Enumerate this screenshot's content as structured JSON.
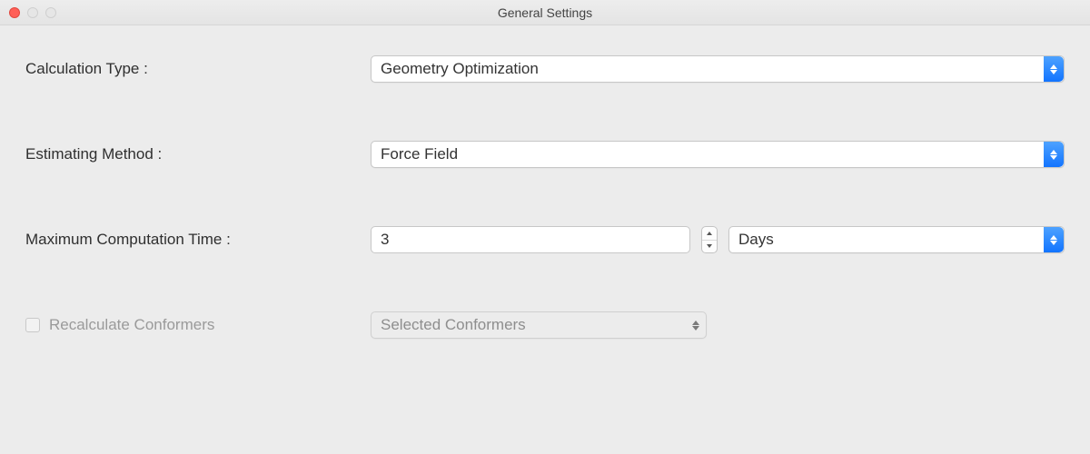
{
  "window": {
    "title": "General Settings"
  },
  "fields": {
    "calculation_type": {
      "label": "Calculation Type :",
      "value": "Geometry Optimization"
    },
    "estimating_method": {
      "label": "Estimating Method :",
      "value": "Force Field"
    },
    "max_time": {
      "label": "Maximum Computation Time :",
      "value": "3",
      "unit": "Days"
    },
    "recalculate": {
      "label": "Recalculate Conformers",
      "value": "Selected Conformers"
    }
  }
}
